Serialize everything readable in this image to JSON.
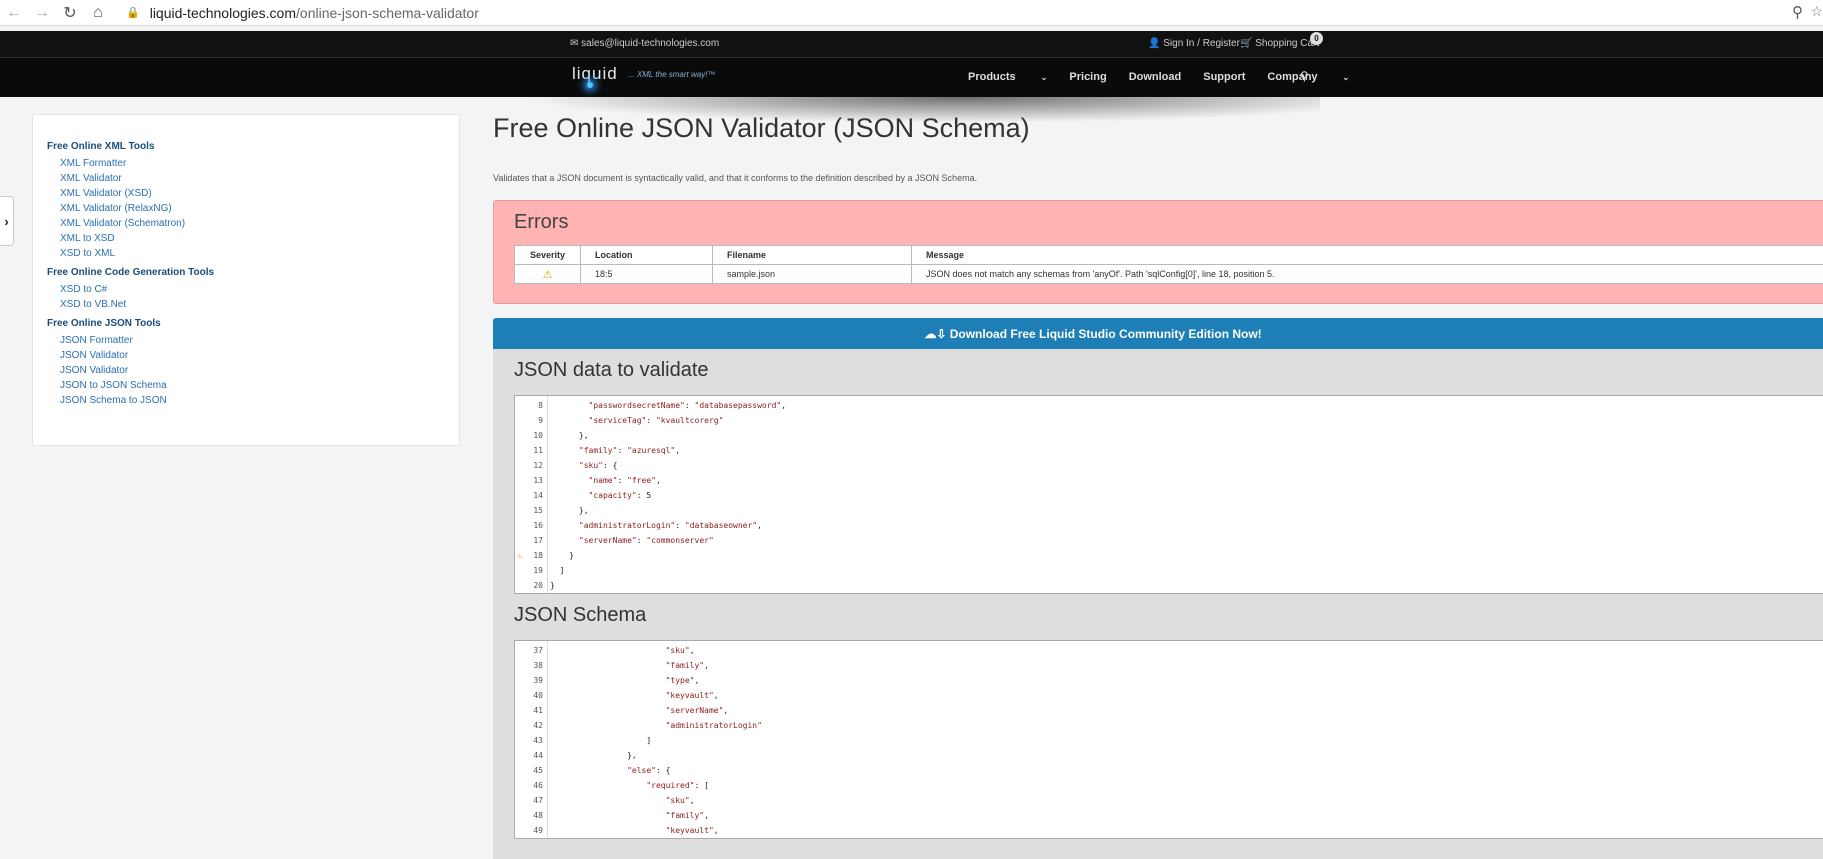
{
  "browser": {
    "url_domain": "liquid-technologies.com",
    "url_path": "/online-json-schema-validator"
  },
  "topbar": {
    "email": "sales@liquid-technologies.com",
    "signin": "Sign In / Register",
    "cart": "Shopping Cart",
    "cart_count": "0"
  },
  "nav": {
    "logo": "liquid",
    "tagline": "... XML the smart way!™",
    "items": [
      "Products",
      "Pricing",
      "Download",
      "Support",
      "Company"
    ]
  },
  "sidebar": {
    "groups": [
      {
        "title": "Free Online XML Tools",
        "links": [
          "XML Formatter",
          "XML Validator",
          "XML Validator (XSD)",
          "XML Validator (RelaxNG)",
          "XML Validator (Schematron)",
          "XML to XSD",
          "XSD to XML"
        ]
      },
      {
        "title": "Free Online Code Generation Tools",
        "links": [
          "XSD to C#",
          "XSD to VB.Net"
        ]
      },
      {
        "title": "Free Online JSON Tools",
        "links": [
          "JSON Formatter",
          "JSON Validator",
          "JSON Validator",
          "JSON to JSON Schema",
          "JSON Schema to JSON"
        ]
      }
    ]
  },
  "main": {
    "title": "Free Online JSON Validator (JSON Schema)",
    "description": "Validates that a JSON document is syntactically valid, and that it conforms to the definition described by a JSON Schema."
  },
  "errors": {
    "title": "Errors",
    "headers": [
      "Severity",
      "Location",
      "Filename",
      "Message"
    ],
    "rows": [
      {
        "location": "18:5",
        "filename": "sample.json",
        "message": "JSON does not match any schemas from 'anyOf'. Path 'sqlConfig[0]', line 18, position 5."
      }
    ]
  },
  "download_banner": "Download Free Liquid Studio Community Edition Now!",
  "json_data": {
    "title": "JSON data to validate",
    "lines": [
      {
        "n": "8",
        "t": "        \"passwordsecretName\": \"databasepassword\","
      },
      {
        "n": "9",
        "t": "        \"serviceTag\": \"kvaultcorerg\""
      },
      {
        "n": "10",
        "t": "      },"
      },
      {
        "n": "11",
        "t": "      \"family\": \"azuresql\","
      },
      {
        "n": "12",
        "t": "      \"sku\": {"
      },
      {
        "n": "13",
        "t": "        \"name\": \"free\","
      },
      {
        "n": "14",
        "t": "        \"capacity\": 5"
      },
      {
        "n": "15",
        "t": "      },"
      },
      {
        "n": "16",
        "t": "      \"administratorLogin\": \"databaseowner\","
      },
      {
        "n": "17",
        "t": "      \"serverName\": \"commonserver\""
      },
      {
        "n": "18",
        "t": "    }"
      },
      {
        "n": "19",
        "t": "  ]"
      },
      {
        "n": "20",
        "t": "}"
      }
    ]
  },
  "json_schema": {
    "title": "JSON Schema",
    "lines": [
      {
        "n": "37",
        "t": "                        \"sku\","
      },
      {
        "n": "38",
        "t": "                        \"family\","
      },
      {
        "n": "39",
        "t": "                        \"type\","
      },
      {
        "n": "40",
        "t": "                        \"keyvault\","
      },
      {
        "n": "41",
        "t": "                        \"serverName\","
      },
      {
        "n": "42",
        "t": "                        \"administratorLogin\""
      },
      {
        "n": "43",
        "t": "                    ]"
      },
      {
        "n": "44",
        "t": "                },"
      },
      {
        "n": "45",
        "t": "                \"else\": {"
      },
      {
        "n": "46",
        "t": "                    \"required\": ["
      },
      {
        "n": "47",
        "t": "                        \"sku\","
      },
      {
        "n": "48",
        "t": "                        \"family\","
      },
      {
        "n": "49",
        "t": "                        \"keyvault\","
      }
    ]
  },
  "colors": {
    "error_bg": "#ffb3b3",
    "banner": "#1d7fb5",
    "link": "#2a6fb0",
    "string": "#8b1a1a"
  }
}
